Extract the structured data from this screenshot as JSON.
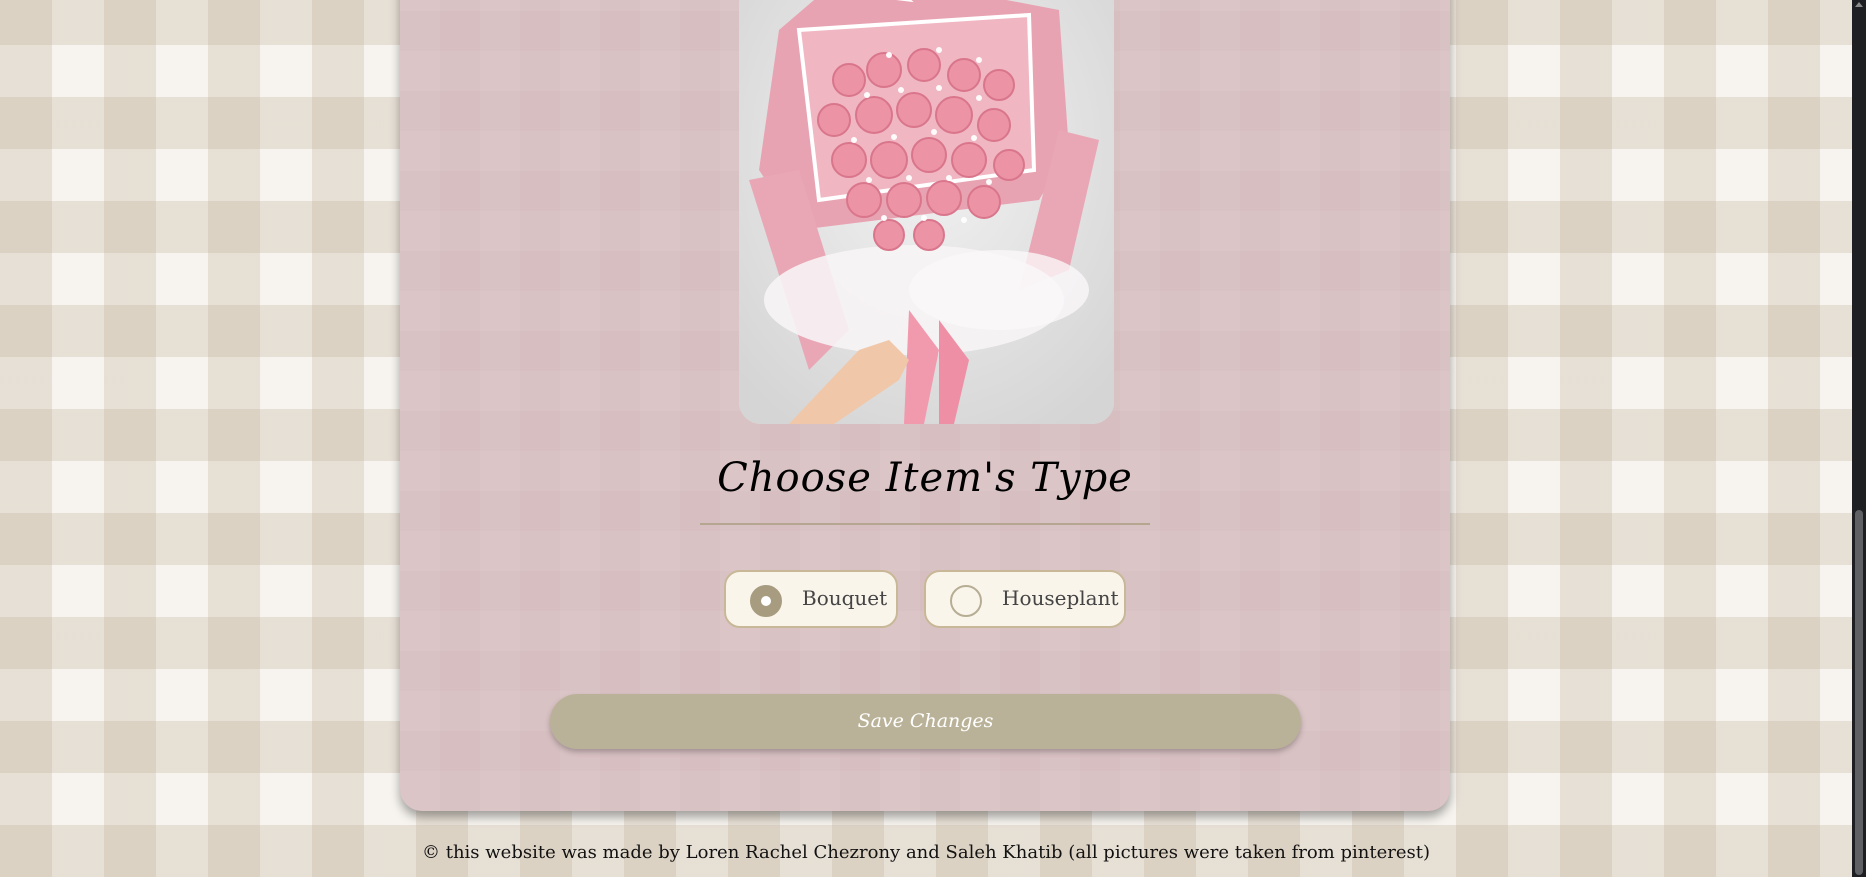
{
  "item_type": {
    "title": "Choose Item's Type",
    "options": [
      {
        "label": "Bouquet",
        "selected": true
      },
      {
        "label": "Houseplant",
        "selected": false
      }
    ]
  },
  "actions": {
    "save_label": "Save Changes"
  },
  "footer": {
    "text": "© this website was made by Loren Rachel Chezrony and Saleh Khatib (all pictures were taken from pinterest)"
  },
  "colors": {
    "card": "#d7bfc1",
    "accent": "#bab298",
    "radio_checked": "#a79c80"
  }
}
